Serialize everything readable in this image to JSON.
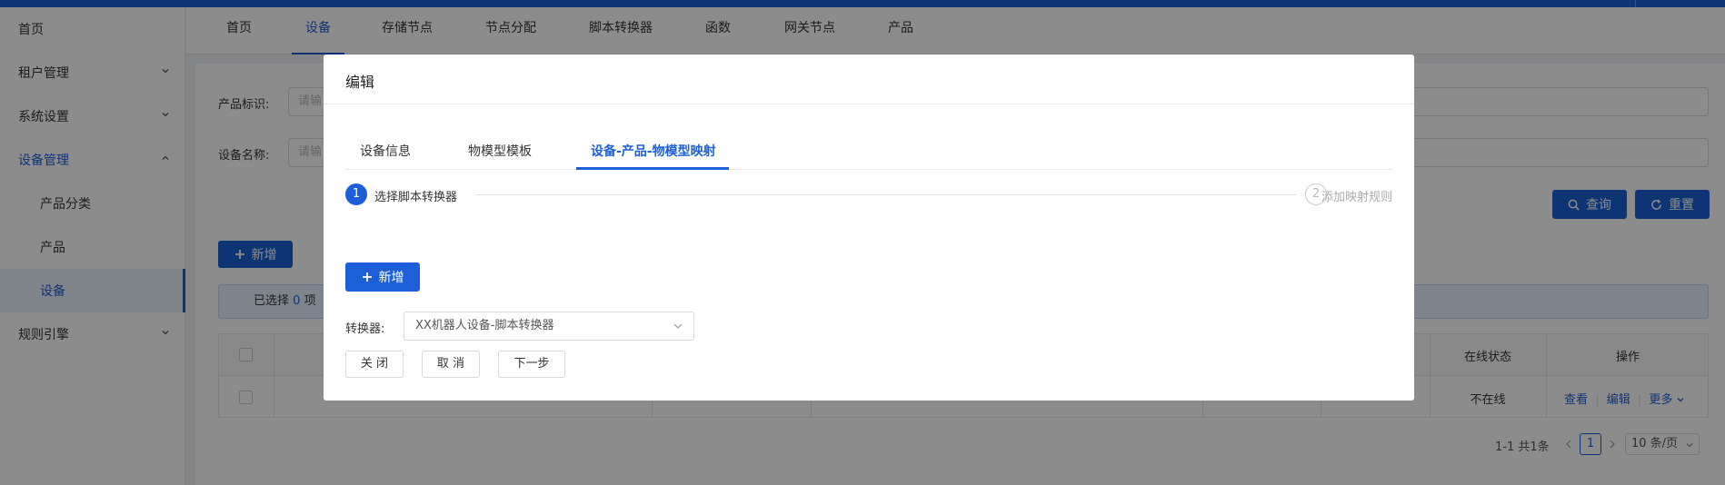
{
  "sidebar": {
    "items": [
      {
        "label": "首页"
      },
      {
        "label": "租户管理"
      },
      {
        "label": "系统设置"
      },
      {
        "label": "设备管理"
      },
      {
        "label": "产品分类"
      },
      {
        "label": "产品"
      },
      {
        "label": "设备"
      },
      {
        "label": "规则引擎"
      }
    ]
  },
  "tabs": [
    {
      "label": "首页"
    },
    {
      "label": "设备"
    },
    {
      "label": "存储节点"
    },
    {
      "label": "节点分配"
    },
    {
      "label": "脚本转换器"
    },
    {
      "label": "函数"
    },
    {
      "label": "网关节点"
    },
    {
      "label": "产品"
    }
  ],
  "filters": {
    "product_label": "产品标识:",
    "product_placeholder": "请输",
    "device_label": "设备名称:",
    "device_placeholder": "请输"
  },
  "buttons": {
    "query": "查询",
    "reset": "重置",
    "add": "新增"
  },
  "selection": {
    "prefix": "已选择",
    "count": "0",
    "suffix": "项"
  },
  "table": {
    "headers": {
      "online_status": "在线状态",
      "actions": "操作"
    },
    "row": {
      "online_status": "不在线",
      "view": "查看",
      "edit": "编辑",
      "more": "更多"
    }
  },
  "pagination": {
    "summary": "1-1 共1条",
    "current_page": "1",
    "page_size": "10 条/页"
  },
  "modal": {
    "title": "编辑",
    "tabs": [
      {
        "label": "设备信息"
      },
      {
        "label": "物模型模板"
      },
      {
        "label": "设备-产品-物模型映射"
      }
    ],
    "steps": [
      {
        "num": "1",
        "label": "选择脚本转换器"
      },
      {
        "num": "2",
        "label": "添加映射规则"
      }
    ],
    "add_button": "新增",
    "converter_label": "转换器:",
    "converter_value": "XX机器人设备-脚本转换器",
    "close_button": "关 闭",
    "cancel_button": "取 消",
    "next_button": "下一步"
  },
  "colors": {
    "primary": "#1d5fd8",
    "mask": "rgba(0,0,0,0.45)"
  }
}
